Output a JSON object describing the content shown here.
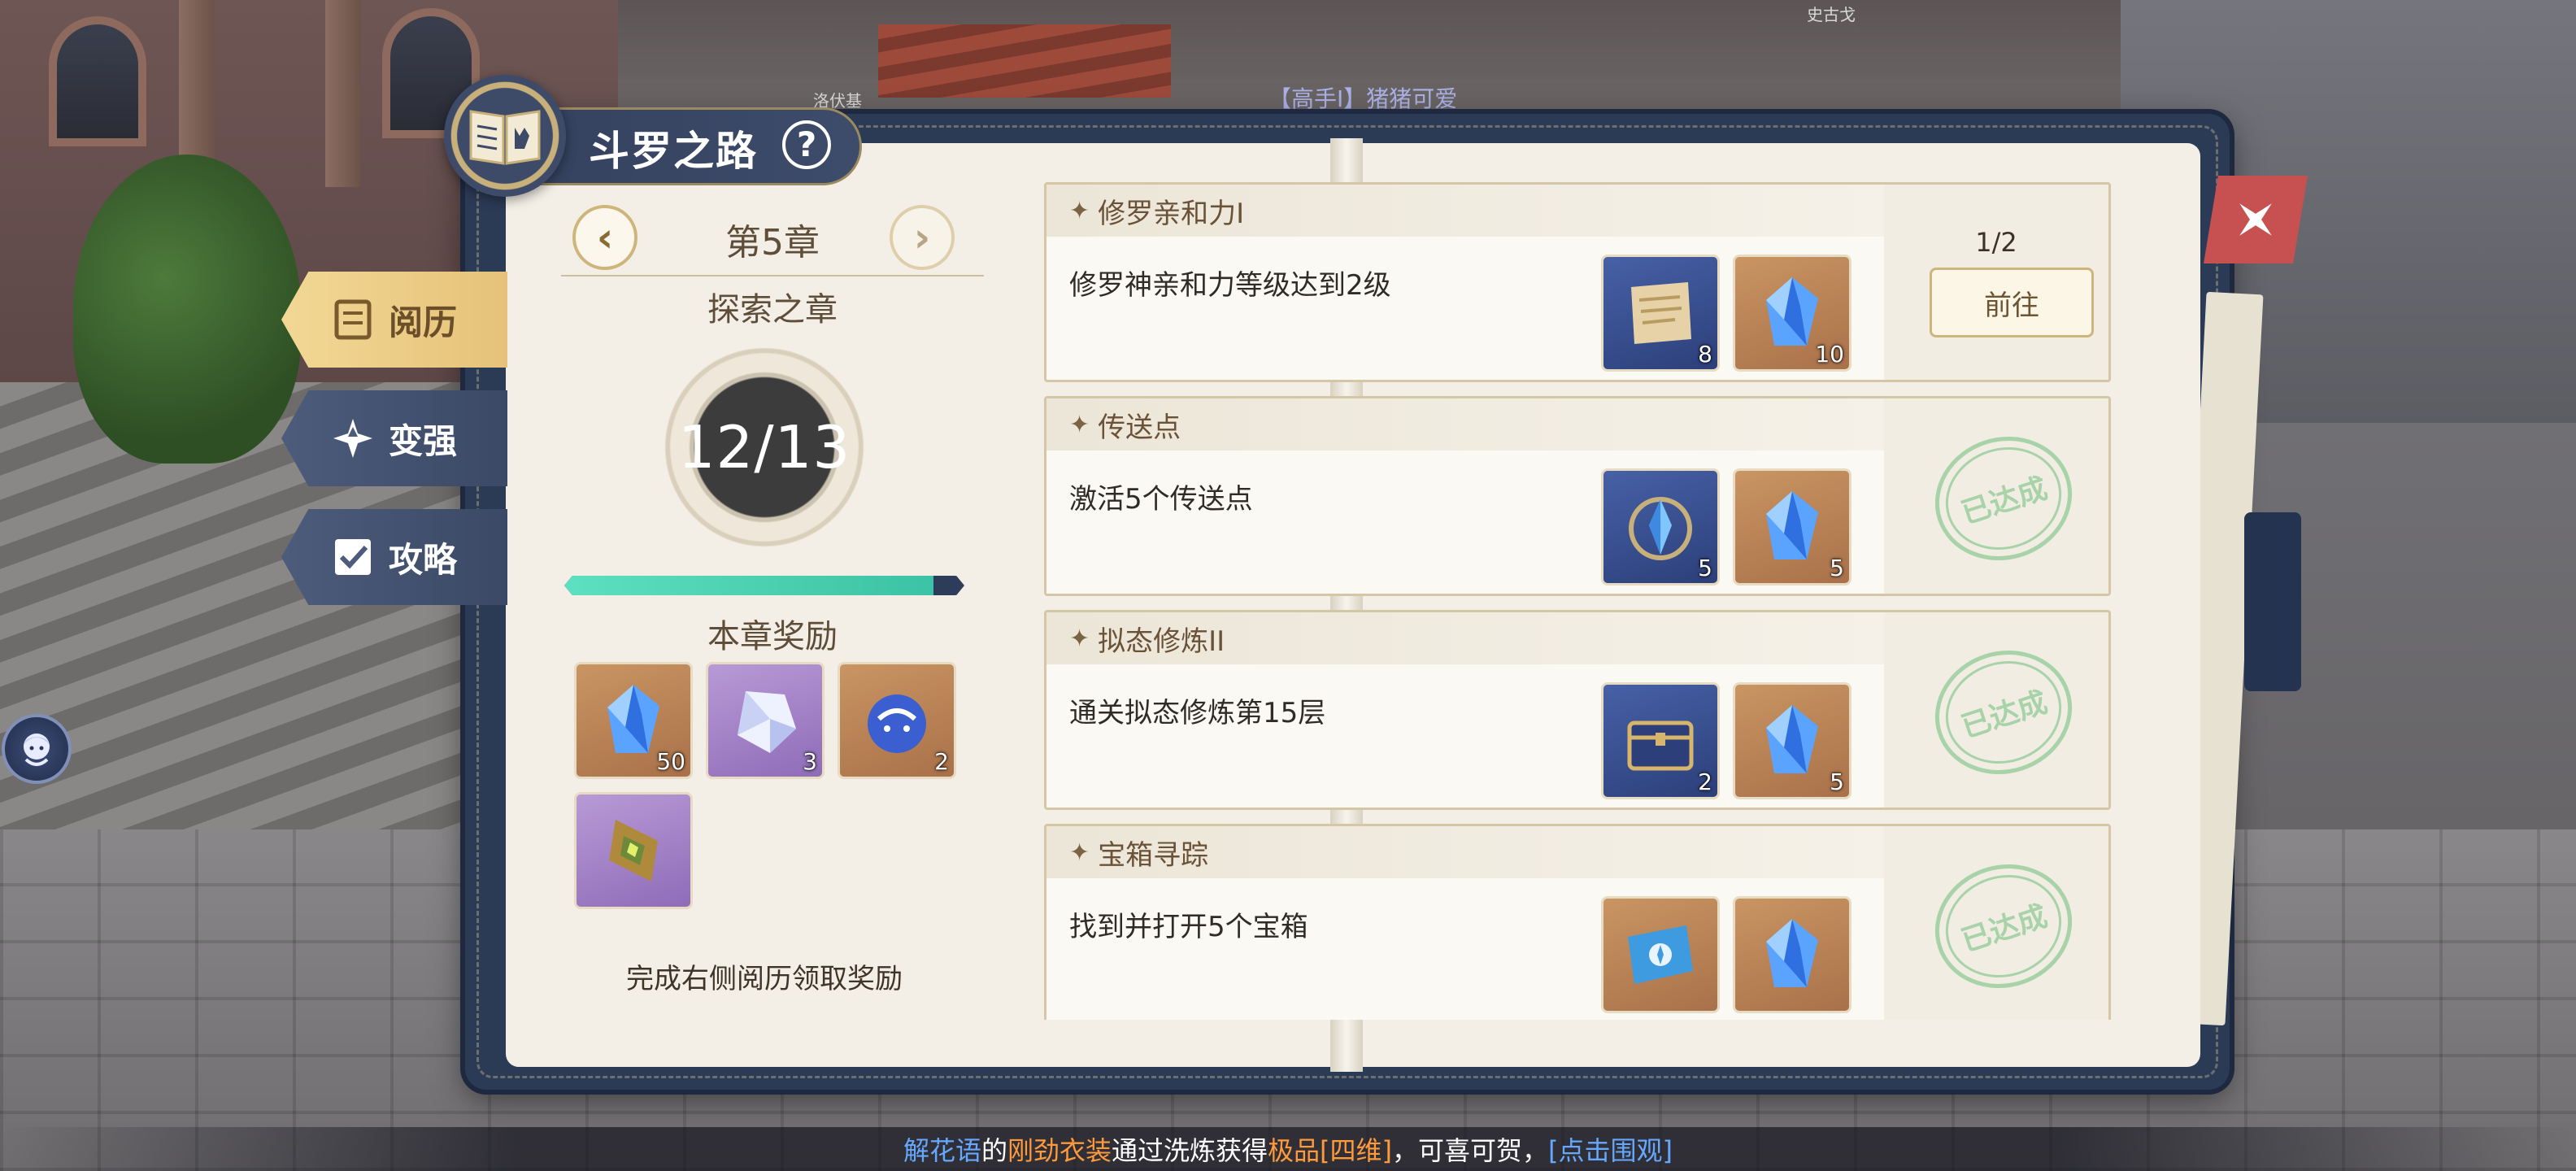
{
  "scene": {
    "npc_names": [
      "洛伏基",
      "史古戈"
    ],
    "chat_overhead": "【高手Ⅰ】猪猪可爱"
  },
  "panel": {
    "title": "斗罗之路",
    "help_symbol": "?"
  },
  "side_tabs": [
    {
      "label": "阅历",
      "icon": "book-icon",
      "active": true
    },
    {
      "label": "变强",
      "icon": "level-up-icon",
      "active": false
    },
    {
      "label": "攻略",
      "icon": "guide-check-icon",
      "active": false
    }
  ],
  "chapter": {
    "title": "第5章",
    "prev_symbol": "‹",
    "next_symbol": "›",
    "explore_title": "探索之章",
    "progress_text": "12/13",
    "progress_fraction": 0.923,
    "rewards_title": "本章奖励",
    "rewards": [
      {
        "icon": "blue-crystal-icon",
        "qty": "50",
        "rarity": "orange"
      },
      {
        "icon": "white-crystal-icon",
        "qty": "3",
        "rarity": "purple"
      },
      {
        "icon": "blue-slime-icon",
        "qty": "2",
        "rarity": "orange"
      },
      {
        "icon": "golden-badge-icon",
        "qty": "",
        "rarity": "purple"
      }
    ],
    "footer_hint": "完成右侧阅历领取奖励"
  },
  "tasks": [
    {
      "title": "修罗亲和力I",
      "description": "修罗神亲和力等级达到2级",
      "rewards": [
        {
          "icon": "scroll-icon",
          "qty": "8",
          "rarity": "blue"
        },
        {
          "icon": "blue-crystal-icon",
          "qty": "10",
          "rarity": "orange"
        }
      ],
      "status": "pending",
      "count": "1/2",
      "button_label": "前往"
    },
    {
      "title": "传送点",
      "description": "激活5个传送点",
      "rewards": [
        {
          "icon": "teleport-crystal-icon",
          "qty": "5",
          "rarity": "blue"
        },
        {
          "icon": "blue-crystal-icon",
          "qty": "5",
          "rarity": "orange"
        }
      ],
      "status": "done",
      "stamp": "已达成"
    },
    {
      "title": "拟态修炼II",
      "description": "通关拟态修炼第15层",
      "rewards": [
        {
          "icon": "treasure-chest-icon",
          "qty": "2",
          "rarity": "blue"
        },
        {
          "icon": "blue-crystal-icon",
          "qty": "5",
          "rarity": "orange"
        }
      ],
      "status": "done",
      "stamp": "已达成"
    },
    {
      "title": "宝箱寻踪",
      "description": "找到并打开5个宝箱",
      "rewards": [
        {
          "icon": "blue-ticket-icon",
          "qty": "",
          "rarity": "orange"
        },
        {
          "icon": "blue-crystal-icon",
          "qty": "",
          "rarity": "orange"
        }
      ],
      "status": "done",
      "stamp": "已达成"
    }
  ],
  "broadcast": [
    {
      "text": "解花语",
      "color": "blue"
    },
    {
      "text": "的",
      "color": "white"
    },
    {
      "text": "刚劲衣装",
      "color": "orange"
    },
    {
      "text": "通过洗炼获得",
      "color": "white"
    },
    {
      "text": "极品",
      "color": "orange"
    },
    {
      "text": "[四维]",
      "color": "orange"
    },
    {
      "text": "，可喜可贺，",
      "color": "white"
    },
    {
      "text": "[点击围观]",
      "color": "blue"
    }
  ],
  "colors": {
    "active_tab": "#f2d895",
    "inactive_tab": "#4d5c7b",
    "progress_fill": "#5de0c0",
    "stamp_green": "#a8d3a9",
    "close_red": "#c65150"
  }
}
